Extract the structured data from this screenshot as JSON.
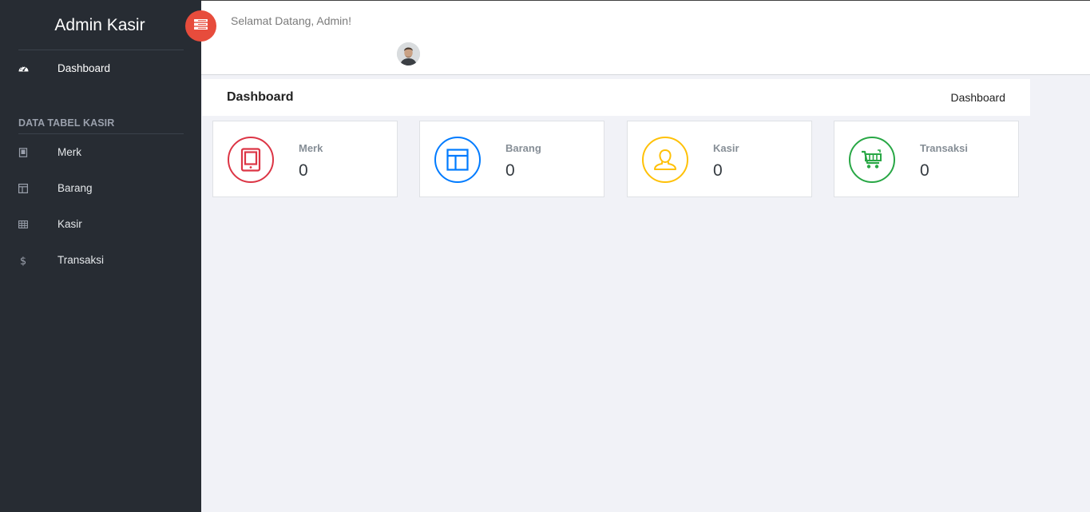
{
  "sidebar": {
    "brand": "Admin Kasir",
    "dashboard": {
      "label": "Dashboard",
      "icon": "dashboard-icon"
    },
    "section_title": "DATA TABEL KASIR",
    "items": [
      {
        "label": "Merk",
        "icon": "book-icon"
      },
      {
        "label": "Barang",
        "icon": "layout-icon"
      },
      {
        "label": "Kasir",
        "icon": "table-icon"
      },
      {
        "label": "Transaksi",
        "icon": "dollar-icon"
      }
    ]
  },
  "header": {
    "welcome": "Selamat Datang, Admin!",
    "toggle_icon": "menu-icon",
    "toggle_color": "#e74c3c"
  },
  "breadcrumbs": {
    "title": "Dashboard",
    "current": "Dashboard"
  },
  "stats": [
    {
      "label": "Merk",
      "value": "0",
      "icon": "tablet-icon",
      "color": "#dc3545"
    },
    {
      "label": "Barang",
      "value": "0",
      "icon": "layout-icon",
      "color": "#007bff"
    },
    {
      "label": "Kasir",
      "value": "0",
      "icon": "user-icon",
      "color": "#ffc107"
    },
    {
      "label": "Transaksi",
      "value": "0",
      "icon": "cart-icon",
      "color": "#28a745"
    }
  ]
}
